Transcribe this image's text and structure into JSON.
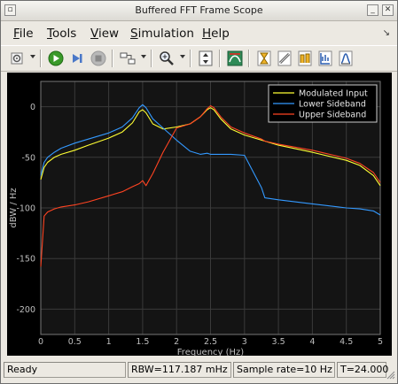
{
  "window": {
    "title": "Buffered FFT Frame Scope"
  },
  "menu": {
    "items": [
      {
        "label": "File",
        "u": "F",
        "rest": "ile"
      },
      {
        "label": "Tools",
        "u": "T",
        "rest": "ools"
      },
      {
        "label": "View",
        "u": "V",
        "rest": "iew"
      },
      {
        "label": "Simulation",
        "u": "S",
        "rest": "imulation"
      },
      {
        "label": "Help",
        "u": "H",
        "rest": "elp"
      }
    ]
  },
  "toolbar": {
    "icons": [
      "parameters-icon",
      "run-icon",
      "step-forward-icon",
      "stop-icon",
      "highlight-block-icon",
      "zoom-icon",
      "scale-axes-icon",
      "measurement-icon",
      "cursor-icon",
      "peak-finder-icon",
      "bilevel-icon",
      "spectral-mask-icon",
      "signal-stats-icon"
    ]
  },
  "status": {
    "ready": "Ready",
    "rbw": "RBW=117.187 mHz",
    "sample_rate": "Sample rate=10 Hz",
    "time": "T=24.000"
  },
  "colors": {
    "background": "#000000",
    "axes_bg": "#141414",
    "grid": "#3a3a3a",
    "axis_text": "#bfbfbf",
    "modulated": "#ffff33",
    "lower": "#3399ff",
    "upper": "#ff4422"
  },
  "chart_data": {
    "type": "line",
    "title": "",
    "xlabel": "Frequency (Hz)",
    "ylabel": "dBW / Hz",
    "xlim": [
      0,
      5
    ],
    "ylim": [
      -225,
      25
    ],
    "xticks": [
      "0",
      "0.5",
      "1",
      "1.5",
      "2",
      "2.5",
      "3",
      "3.5",
      "4",
      "4.5",
      "5"
    ],
    "yticks": [
      "0",
      "-50",
      "-100",
      "-150",
      "-200"
    ],
    "grid": true,
    "legend_position": "top-right",
    "x": [
      0,
      0.05,
      0.1,
      0.2,
      0.3,
      0.5,
      0.7,
      1.0,
      1.2,
      1.35,
      1.45,
      1.5,
      1.55,
      1.65,
      1.8,
      2.0,
      2.2,
      2.35,
      2.45,
      2.5,
      2.55,
      2.65,
      2.8,
      3.0,
      3.25,
      3.3,
      3.5,
      4.0,
      4.5,
      4.7,
      4.9,
      5.0
    ],
    "series": [
      {
        "name": "Modulated Input",
        "color": "#ffff33",
        "values": [
          -72,
          -60,
          -55,
          -50,
          -47,
          -43,
          -38,
          -31,
          -25,
          -16,
          -5,
          -3,
          -6,
          -17,
          -22,
          -20,
          -17,
          -10,
          -3,
          -1,
          -3,
          -12,
          -22,
          -28,
          -33,
          -34,
          -38,
          -45,
          -53,
          -58,
          -68,
          -78
        ]
      },
      {
        "name": "Lower Sideband",
        "color": "#3399ff",
        "values": [
          -68,
          -55,
          -50,
          -45,
          -41,
          -36,
          -32,
          -26,
          -20,
          -11,
          -1,
          2,
          -1,
          -12,
          -21,
          -33,
          -44,
          -47,
          -46,
          -47,
          -47,
          -47,
          -47,
          -48,
          -80,
          -90,
          -92,
          -96,
          -100,
          -101,
          -103,
          -107
        ]
      },
      {
        "name": "Upper Sideband",
        "color": "#ff4422",
        "values": [
          -158,
          -108,
          -104,
          -101,
          -99,
          -97,
          -94,
          -88,
          -84,
          -79,
          -76,
          -73,
          -78,
          -66,
          -45,
          -21,
          -17,
          -10,
          -2,
          1,
          -1,
          -10,
          -20,
          -26,
          -32,
          -34,
          -37,
          -43,
          -51,
          -56,
          -65,
          -75
        ]
      }
    ]
  }
}
